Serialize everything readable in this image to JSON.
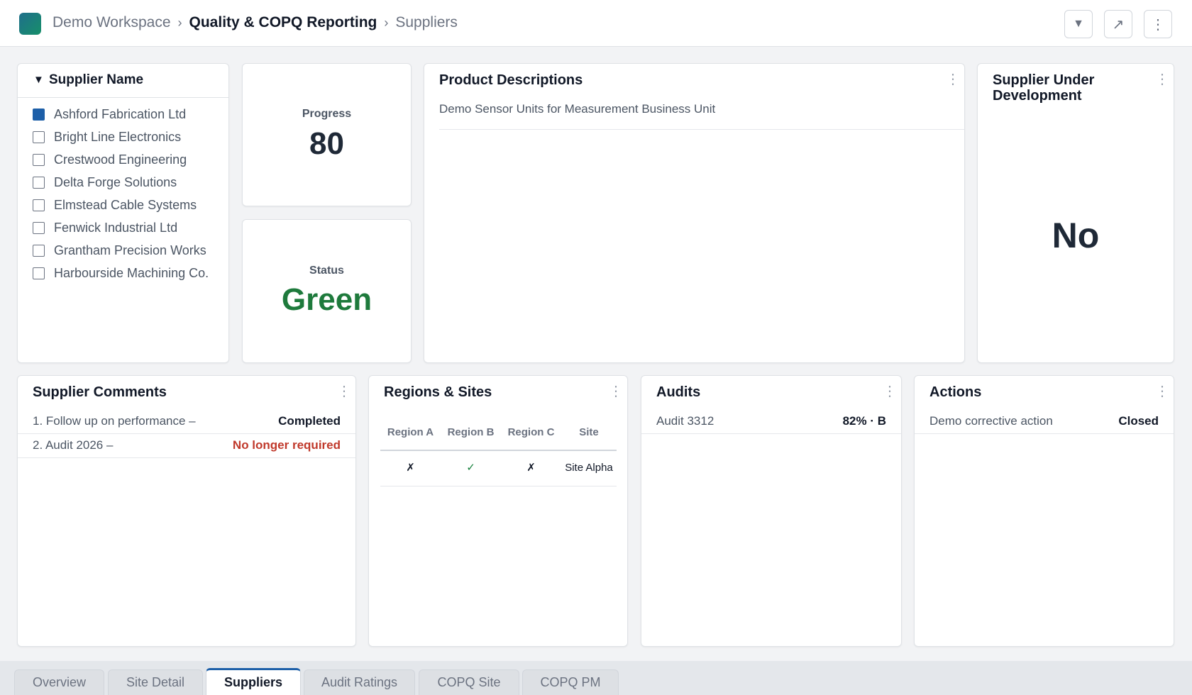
{
  "header": {
    "breadcrumb": [
      "Demo Workspace",
      "Quality & COPQ Reporting",
      "Suppliers"
    ],
    "separator": "›",
    "buttons": [
      {
        "name": "filter-button",
        "icon": "filter-icon",
        "glyph": "▼"
      },
      {
        "name": "expand-button",
        "icon": "expand-icon",
        "glyph": "↗"
      },
      {
        "name": "more-button",
        "icon": "more-vertical-icon",
        "glyph": "⋮"
      }
    ]
  },
  "filter": {
    "title": "Supplier Name",
    "toggle_glyph": "▼",
    "items": [
      {
        "label": "Ashford Fabrication Ltd",
        "checked": true
      },
      {
        "label": "Bright Line Electronics",
        "checked": false
      },
      {
        "label": "Crestwood Engineering",
        "checked": false
      },
      {
        "label": "Delta Forge Solutions",
        "checked": false
      },
      {
        "label": "Elmstead Cable Systems",
        "checked": false
      },
      {
        "label": "Fenwick Industrial Ltd",
        "checked": false
      },
      {
        "label": "Grantham Precision Works",
        "checked": false
      },
      {
        "label": "Harbourside Machining Co.",
        "checked": false
      }
    ]
  },
  "progress": {
    "label": "Progress",
    "value": "80"
  },
  "status": {
    "label": "Status",
    "value": "Green",
    "color": "#1e7a3c"
  },
  "product": {
    "title": "Product Descriptions",
    "description": "Demo Sensor Units for Measurement Business Unit"
  },
  "development": {
    "title": "Supplier Under Development",
    "value": "No"
  },
  "comments": {
    "title": "Supplier Comments",
    "rows": [
      {
        "text": "1. Follow up on performance –",
        "status": "Completed",
        "color": "#111827"
      },
      {
        "text": "2. Audit 2026 –",
        "status": "No longer required",
        "color": "#c0392b"
      }
    ]
  },
  "regions": {
    "title": "Regions & Sites",
    "headers": [
      "Region A",
      "Region B",
      "Region C",
      "Site"
    ],
    "rows": [
      {
        "region_a": "✗",
        "region_b": "✓",
        "region_c": "✗",
        "site": "Site Alpha"
      }
    ]
  },
  "audits": {
    "title": "Audits",
    "rows": [
      {
        "name": "Audit 3312",
        "score": "82% · B"
      }
    ]
  },
  "actions": {
    "title": "Actions",
    "rows": [
      {
        "name": "Demo corrective action",
        "state": "Closed"
      }
    ]
  },
  "kebab_glyph": "⋮",
  "tabs": [
    {
      "label": "Overview",
      "active": false
    },
    {
      "label": "Site Detail",
      "active": false
    },
    {
      "label": "Suppliers",
      "active": true
    },
    {
      "label": "Audit Ratings",
      "active": false
    },
    {
      "label": "COPQ Site",
      "active": false
    },
    {
      "label": "COPQ PM",
      "active": false
    }
  ]
}
